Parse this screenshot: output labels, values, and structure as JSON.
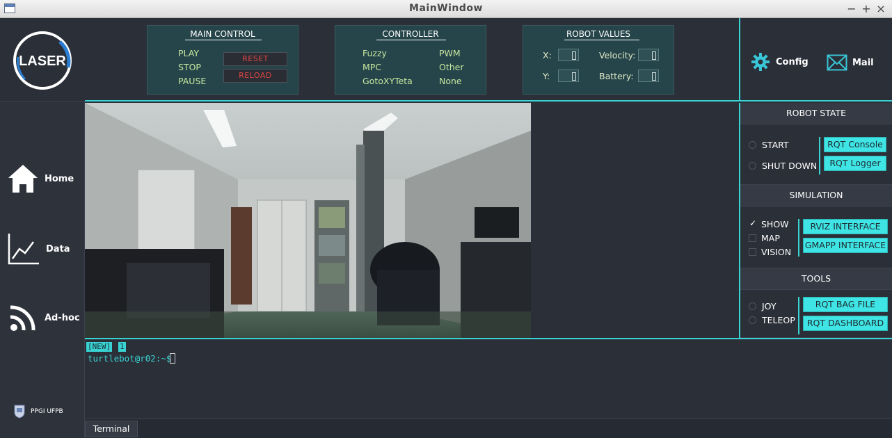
{
  "window": {
    "title": "MainWindow",
    "minimize": "−",
    "maximize": "+",
    "close": "×"
  },
  "sidebar": {
    "logo_text": "LASER",
    "items": [
      {
        "label": "Home",
        "icon": "home-icon"
      },
      {
        "label": "Data",
        "icon": "chart-line-icon"
      },
      {
        "label": "Ad-hoc",
        "icon": "wifi-signal-icon"
      }
    ],
    "footer": "PPGI UFPB"
  },
  "main_control": {
    "title": "MAIN CONTROL",
    "items": [
      "PLAY",
      "STOP",
      "PAUSE"
    ],
    "reset_label": "RESET",
    "reload_label": "RELOAD"
  },
  "controller": {
    "title": "CONTROLLER",
    "col1": [
      "Fuzzy",
      "MPC",
      "GotoXYTeta"
    ],
    "col2": [
      "PWM",
      "Other",
      "None"
    ]
  },
  "robot_values": {
    "title": "ROBOT VALUES",
    "x_label": "X:",
    "y_label": "Y:",
    "velocity_label": "Velocity:",
    "battery_label": "Battery:"
  },
  "header_buttons": {
    "config": "Config",
    "mail": "Mail"
  },
  "robot_state": {
    "title": "ROBOT STATE",
    "options": [
      "START",
      "SHUT DOWN"
    ],
    "buttons": [
      "RQT Console",
      "RQT Logger"
    ]
  },
  "simulation": {
    "title": "SIMULATION",
    "options": [
      {
        "label": "SHOW",
        "checked": true
      },
      {
        "label": "MAP",
        "checked": false
      },
      {
        "label": "VISION",
        "checked": false
      }
    ],
    "buttons": [
      "RVIZ INTERFACE",
      "GMAPP INTERFACE"
    ]
  },
  "tools": {
    "title": "TOOLS",
    "options": [
      "JOY",
      "TELEOP"
    ],
    "buttons": [
      "RQT BAG FILE",
      "RQT DASHBOARD"
    ]
  },
  "terminal": {
    "tab1": "[NEW]",
    "tab2": "1",
    "prompt": "turtlebot@r02:~$",
    "tab_label": "Terminal"
  },
  "colors": {
    "accent": "#39d3d3",
    "panel": "#26454a",
    "background": "#2b2f38",
    "green_text": "#c7e7a0",
    "led_red": "#e04545"
  }
}
